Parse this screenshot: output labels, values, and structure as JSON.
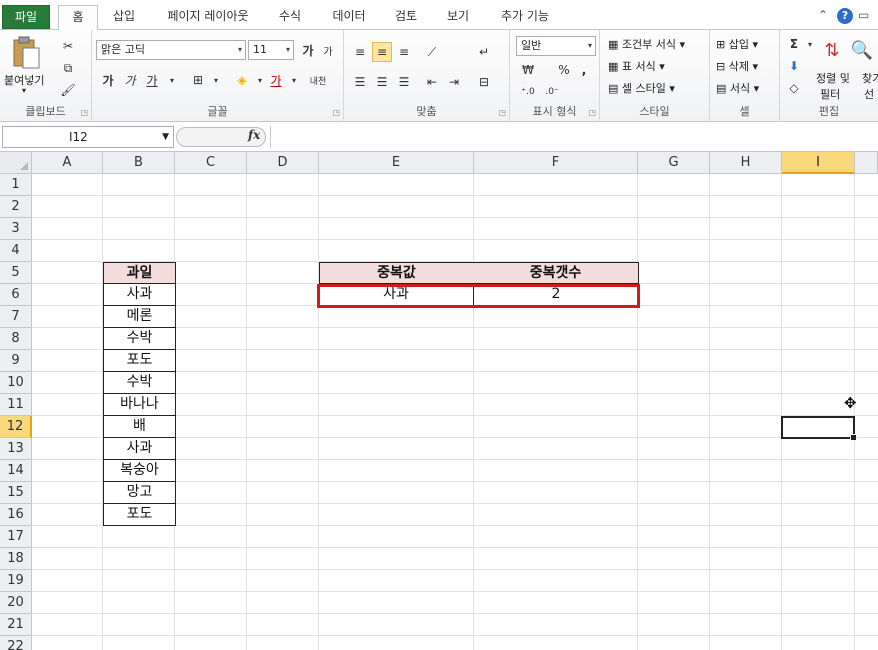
{
  "tabs": [
    {
      "label": "파일"
    },
    {
      "label": "홈"
    },
    {
      "label": "삽입"
    },
    {
      "label": "페이지 레이아웃"
    },
    {
      "label": "수식"
    },
    {
      "label": "데이터"
    },
    {
      "label": "검토"
    },
    {
      "label": "보기"
    },
    {
      "label": "추가 기능"
    }
  ],
  "ribbon": {
    "clipboard": {
      "paste": "붙여넣기",
      "label": "클립보드"
    },
    "font": {
      "name": "맑은 고딕",
      "size": "11",
      "label": "글꼴",
      "bold": "가",
      "italic": "가",
      "underline": "가",
      "color_letter": "가",
      "phonetic": "내천"
    },
    "alignment": {
      "label": "맞춤"
    },
    "number": {
      "format": "일반",
      "percent": "%",
      "comma": ",",
      "label": "표시 형식"
    },
    "styles": {
      "conditional": "조건부 서식",
      "table": "표 서식",
      "cell": "셀 스타일",
      "label": "스타일"
    },
    "cells": {
      "insert": "삽입",
      "delete": "삭제",
      "format": "서식",
      "label": "셀"
    },
    "editing": {
      "sigma": "Σ",
      "sort": "정렬 및",
      "filter": "필터",
      "find": "찾기",
      "find2": "선",
      "label": "편집"
    }
  },
  "formula_bar": {
    "name_box": "I12",
    "fx": "fx",
    "formula": ""
  },
  "columns": [
    "A",
    "B",
    "C",
    "D",
    "E",
    "F",
    "G",
    "H",
    "I"
  ],
  "rows": [
    "1",
    "2",
    "3",
    "4",
    "5",
    "6",
    "7",
    "8",
    "9",
    "10",
    "11",
    "12",
    "13",
    "14",
    "15",
    "16",
    "17",
    "18",
    "19",
    "20",
    "21",
    "22"
  ],
  "active_cell": "I12",
  "sheet": {
    "fruit_header": "과일",
    "fruits": [
      "사과",
      "메론",
      "수박",
      "포도",
      "수박",
      "바나나",
      "배",
      "사과",
      "복숭아",
      "망고",
      "포도"
    ],
    "summary": {
      "header_value": "중복값",
      "header_count": "중복갯수",
      "value": "사과",
      "count": "2"
    }
  },
  "colors": {
    "file_tab": "#2a7a3a",
    "header_fill": "#f3dcdc",
    "highlight_border": "#d11a1a",
    "selected_header": "#f9d87c"
  }
}
